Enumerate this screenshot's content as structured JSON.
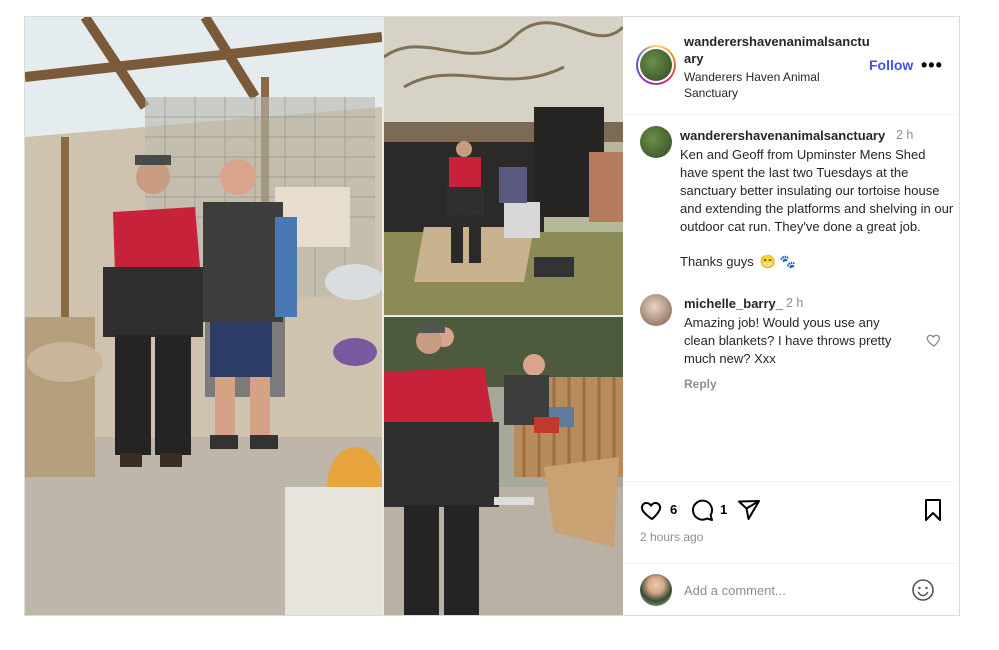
{
  "post": {
    "author": {
      "username": "wanderershavenanimalsanctuary",
      "display_name": "Wanderers Haven Animal Sanctuary"
    },
    "follow_label": "Follow",
    "more_label": "•••",
    "caption": {
      "username": "wanderershavenanimalsanctuary",
      "time": "2 h",
      "text": "Ken and Geoff from Upminster Mens Shed have spent the last two Tuesdays at the sanctuary better insulating our tortoise house and extending the platforms and shelving in our outdoor cat run. They've done a great job.",
      "thanks": "Thanks guys",
      "emojis": "😁 🐾"
    },
    "comments": [
      {
        "username": "michelle_barry_",
        "time": "2 h",
        "text": "Amazing job! Would yous use any clean blankets? I have throws pretty much new? Xxx",
        "reply_label": "Reply"
      }
    ],
    "likes_count": "6",
    "comments_count": "1",
    "posted_ago": "2 hours ago",
    "add_comment_placeholder": "Add a comment..."
  },
  "icons": {
    "like": "heart-icon",
    "comment": "comment-bubble-icon",
    "share": "paper-plane-icon",
    "save": "bookmark-icon",
    "emoji": "smiley-icon",
    "more": "more-dots-icon"
  },
  "colors": {
    "follow": "#4150f7",
    "secondary_text": "#8e8e8e",
    "border": "#dbdbdb"
  }
}
